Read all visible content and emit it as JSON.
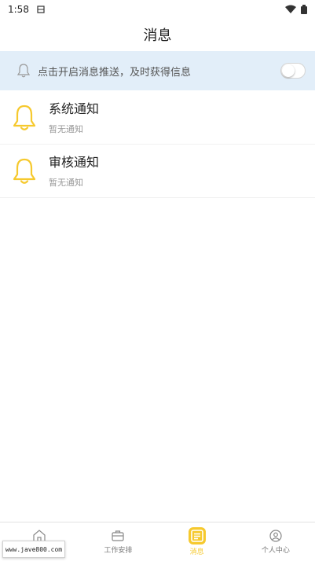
{
  "status_bar": {
    "time": "1:58"
  },
  "header": {
    "title": "消息"
  },
  "push_banner": {
    "text": "点击开启消息推送，及时获得信息",
    "toggle_on": false
  },
  "messages": [
    {
      "title": "系统通知",
      "subtitle": "暂无通知",
      "icon": "bell-icon"
    },
    {
      "title": "审核通知",
      "subtitle": "暂无通知",
      "icon": "bell-icon"
    }
  ],
  "tabbar": {
    "tabs": [
      {
        "label": "首页",
        "icon": "home-icon"
      },
      {
        "label": "工作安排",
        "icon": "briefcase-icon"
      },
      {
        "label": "消息",
        "icon": "message-icon",
        "active": true
      },
      {
        "label": "个人中心",
        "icon": "user-icon"
      }
    ]
  },
  "watermark": {
    "text": "www.jave800.com"
  },
  "colors": {
    "accent": "#f6c92e",
    "banner_bg": "#e2eef9"
  }
}
